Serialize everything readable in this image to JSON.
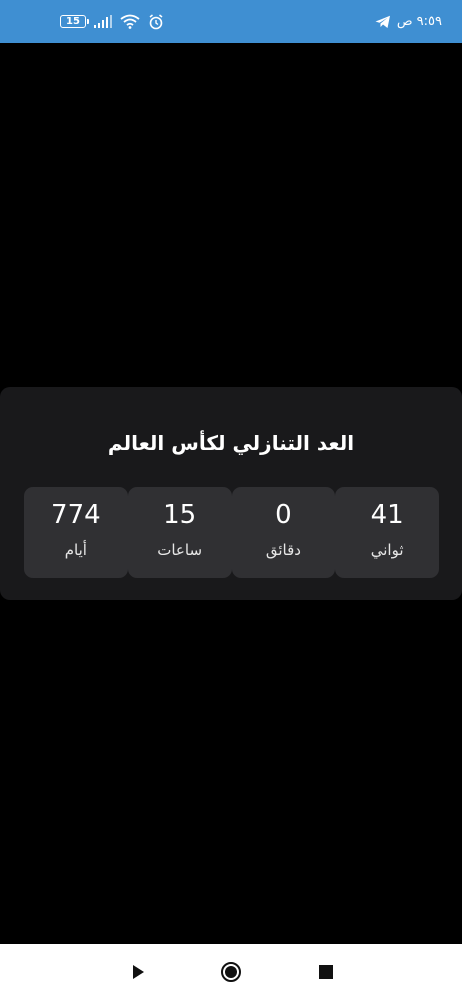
{
  "status_bar": {
    "battery_level": "15",
    "time": "٩:٥٩ ص",
    "icons": [
      "battery-icon",
      "signal-icon",
      "wifi-icon",
      "alarm-icon",
      "telegram-icon"
    ]
  },
  "countdown": {
    "title": "العد التنازلي لكأس العالم",
    "units": [
      {
        "value": "41",
        "label": "ثواني"
      },
      {
        "value": "0",
        "label": "دقائق"
      },
      {
        "value": "15",
        "label": "ساعات"
      },
      {
        "value": "774",
        "label": "أيام"
      }
    ]
  },
  "nav_bar": {
    "icons": [
      "back-triangle-icon",
      "home-circle-icon",
      "recents-square-icon"
    ]
  },
  "colors": {
    "status_bar": "#3f8fd2",
    "background": "#000000",
    "card": "#19191b",
    "box": "#303033",
    "battery_low": "#ff4d4d"
  }
}
